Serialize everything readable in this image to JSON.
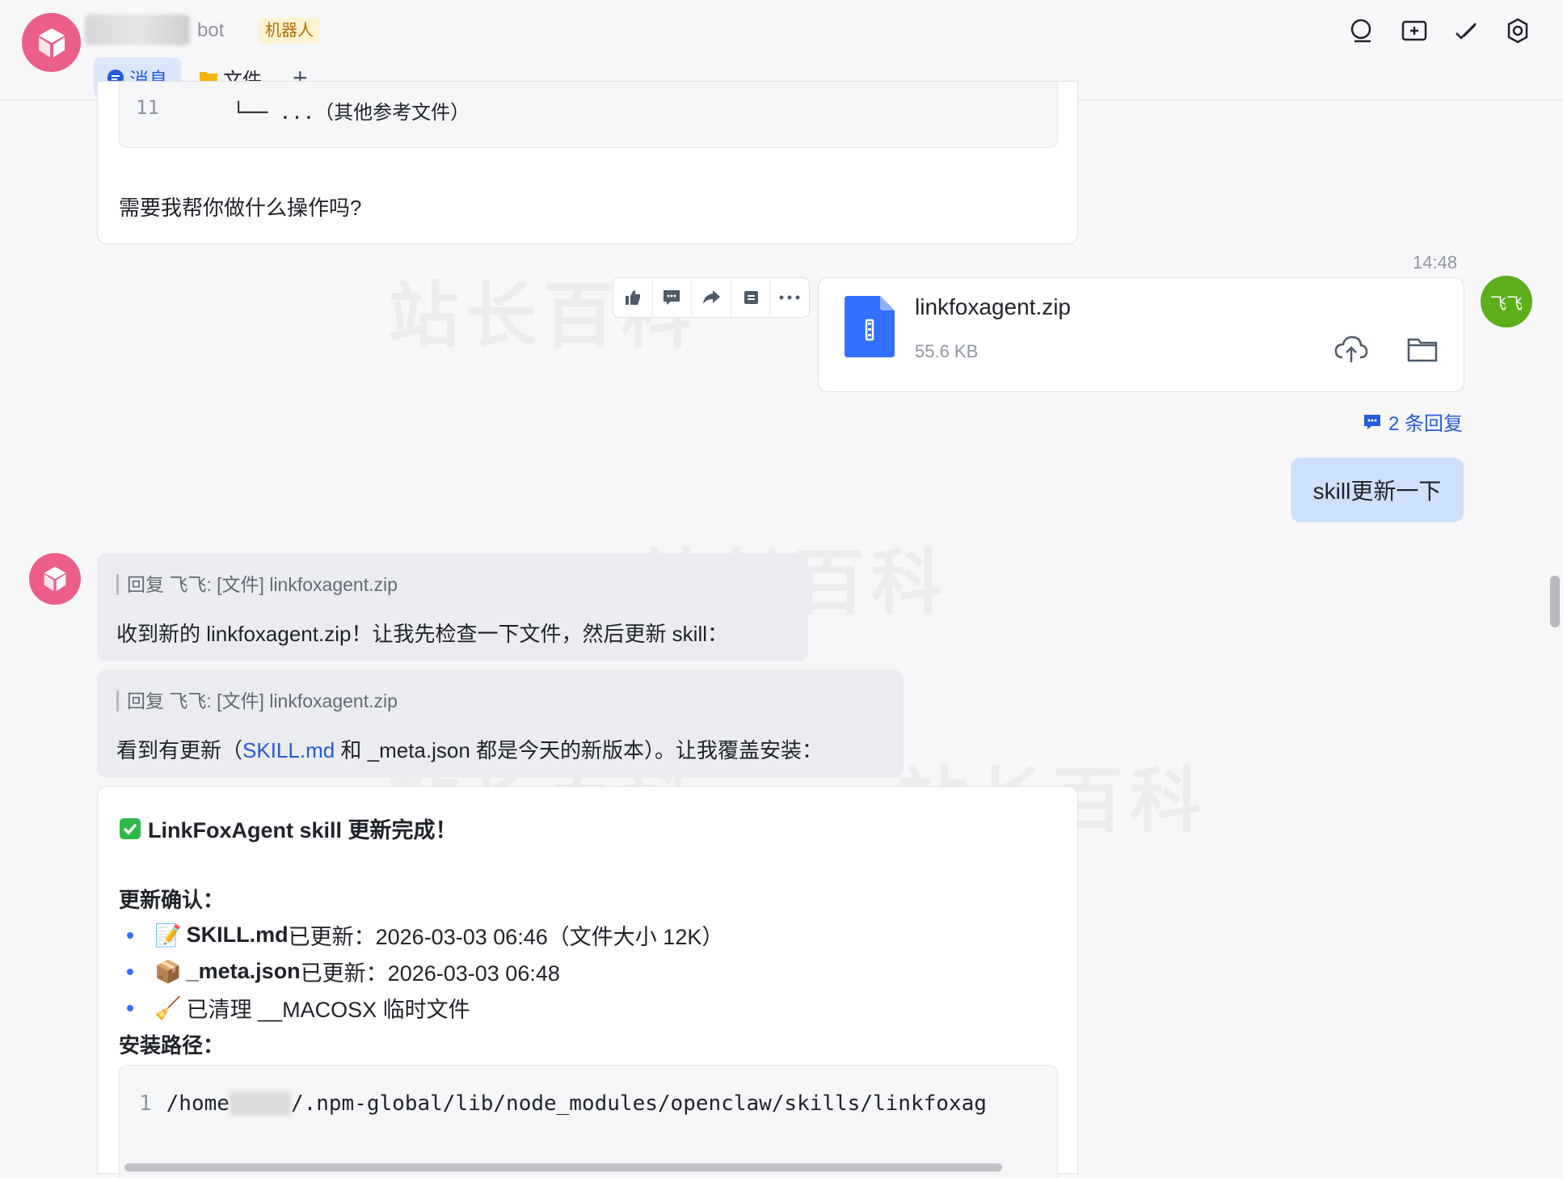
{
  "header": {
    "bot_suffix": "bot",
    "badge": "机器人",
    "tabs": [
      {
        "label": "消息"
      },
      {
        "label": "文件"
      },
      {
        "label": "+"
      }
    ]
  },
  "messages": {
    "code_line_number": "11",
    "code_line_text": "└── ...（其他参考文件）",
    "question": "需要我帮你做什么操作吗?",
    "timestamp": "14:48",
    "file": {
      "name": "linkfoxagent.zip",
      "size": "55.6 KB"
    },
    "replies_count": "2 条回复",
    "user_avatar_text": "飞飞",
    "user_message": "skill更新一下",
    "reply1": {
      "quote": "回复 飞飞: [文件] linkfoxagent.zip",
      "text": "收到新的 linkfoxagent.zip！让我先检查一下文件，然后更新 skill："
    },
    "reply2": {
      "quote": "回复 飞飞: [文件] linkfoxagent.zip",
      "text_before": "看到有更新（",
      "link": "SKILL.md",
      "text_after": " 和 _meta.json 都是今天的新版本）。让我覆盖安装："
    },
    "result": {
      "title": "LinkFoxAgent skill 更新完成！",
      "confirm_heading": "更新确认：",
      "items": [
        {
          "emoji": "📝",
          "bold": "SKILL.md",
          "text": " 已更新：2026-03-03 06:46（文件大小 12K）"
        },
        {
          "emoji": "📦",
          "bold": "_meta.json",
          "text": " 已更新：2026-03-03 06:48"
        },
        {
          "emoji": "🧹",
          "bold": "",
          "text": "已清理 __MACOSX 临时文件"
        }
      ],
      "path_heading": "安装路径：",
      "path_line_number": "1",
      "path_prefix": "/home",
      "path_suffix": "/.npm-global/lib/node_modules/openclaw/skills/linkfoxag"
    }
  },
  "watermark_text": "站长百科",
  "colors": {
    "accent": "#245bdb",
    "bot_avatar": "#ec5e8a",
    "user_avatar": "#5eae1c",
    "user_bubble": "#cfe0fc"
  }
}
